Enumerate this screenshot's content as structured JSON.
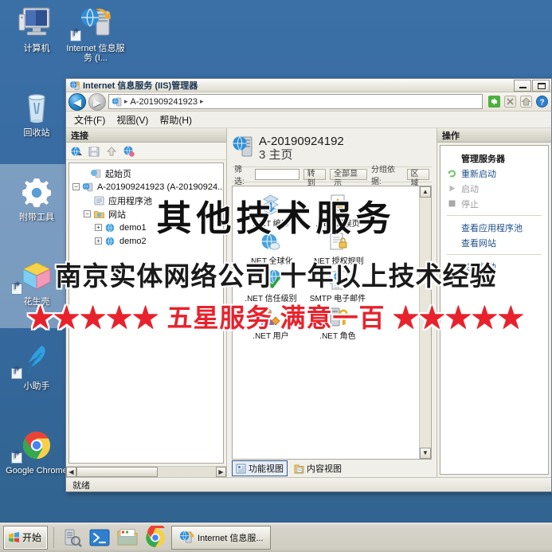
{
  "desktop": {
    "background_color": "#3a6ea5",
    "icons": [
      {
        "name": "computer",
        "label": "计算机",
        "icon": "monitor-icon",
        "shortcut": false
      },
      {
        "name": "iis-manager-shortcut",
        "label": "Internet 信息服务 (I...",
        "icon": "iis-server-icon",
        "shortcut": true
      },
      {
        "name": "recycle-bin",
        "label": "回收站",
        "icon": "recycle-bin-icon",
        "shortcut": false
      },
      {
        "name": "bundled-tools",
        "label": "附带工具",
        "icon": "gear-icon",
        "shortcut": false
      },
      {
        "name": "peanut-shell",
        "label": "花生壳",
        "icon": "cube-icon",
        "shortcut": true
      },
      {
        "name": "assistant",
        "label": "小助手",
        "icon": "feather-icon",
        "shortcut": true
      },
      {
        "name": "google-chrome",
        "label": "Google Chrome",
        "icon": "chrome-icon",
        "shortcut": true
      }
    ]
  },
  "watermarks": {
    "line1": "其他技术服务",
    "line2": "南京实体网络公司  十年以上技术经验",
    "line3": "★★★★★ 五星服务 满意一百 ★★★★★",
    "line3_color": "#e8222c"
  },
  "window": {
    "title": "Internet 信息服务 (IIS)管理器",
    "title_icon": "iis-server-icon",
    "buttons": {
      "minimize": "minimize-icon",
      "maximize": "maximize-icon"
    },
    "address": {
      "icon": "server-icon",
      "separator": "▸",
      "value": "A-201909241923",
      "trailing_separator": "▸"
    },
    "toolbar_icons": [
      "refresh-icon",
      "stop-icon",
      "home-icon",
      "help-icon"
    ],
    "menu": [
      {
        "name": "file",
        "label": "文件(F)"
      },
      {
        "name": "view",
        "label": "视图(V)"
      },
      {
        "name": "help",
        "label": "帮助(H)"
      }
    ],
    "connections": {
      "header": "连接",
      "toolbar_icons": [
        "connect-icon",
        "save-icon",
        "disconnect-icon",
        "connect-site-icon"
      ],
      "tree": [
        {
          "label": "起始页",
          "indent": 1,
          "expander": "",
          "icon": "start-page-icon"
        },
        {
          "label": "A-201909241923 (A-20190924...",
          "indent": 0,
          "expander": "−",
          "icon": "server-icon"
        },
        {
          "label": "应用程序池",
          "indent": 1,
          "expander": "",
          "icon": "app-pool-icon"
        },
        {
          "label": "网站",
          "indent": 1,
          "expander": "−",
          "icon": "sites-folder-icon"
        },
        {
          "label": "demo1",
          "indent": 2,
          "expander": "+",
          "icon": "site-icon"
        },
        {
          "label": "demo2",
          "indent": 2,
          "expander": "+",
          "icon": "site-icon"
        }
      ],
      "hscroll": "horizontal-scrollbar"
    },
    "main": {
      "page_icon": "server-icon",
      "title_line1": "A-20190924192",
      "title_line2": "3  主页",
      "filter": {
        "label": "筛选:",
        "go_label": "转到",
        "show_all_label": "全部显示",
        "group_label": "分组依据:",
        "group_value": "区域"
      },
      "features": [
        {
          "name": "net-compilation",
          "label": ".NET 编译",
          "icon": "net-compilation-icon"
        },
        {
          "name": "net-error-pages",
          "label": ".NET 错误页",
          "icon": "error-pages-icon"
        },
        {
          "name": "net-globalization",
          "label": ".NET 全球化",
          "icon": "globalization-icon"
        },
        {
          "name": "net-authorization-rules",
          "label": ".NET 授权规则",
          "icon": "authorization-icon"
        },
        {
          "name": "net-trust-levels",
          "label": ".NET 信任级别",
          "icon": "trust-levels-icon"
        },
        {
          "name": "smtp-email",
          "label": "SMTP 电子邮件",
          "icon": "smtp-email-icon"
        },
        {
          "name": "net-users",
          "label": ".NET 用户",
          "icon": "users-icon"
        },
        {
          "name": "net-roles",
          "label": ".NET 角色",
          "icon": "roles-key-icon"
        }
      ],
      "view_tabs": [
        {
          "name": "features-view",
          "label": "功能视图",
          "icon": "features-view-icon",
          "active": true
        },
        {
          "name": "content-view",
          "label": "内容视图",
          "icon": "content-view-icon",
          "active": false
        }
      ]
    },
    "actions": {
      "header": "操作",
      "items": [
        {
          "label": "管理服务器",
          "icon": "",
          "state": "bold"
        },
        {
          "label": "重新启动",
          "icon": "restart-icon",
          "state": "normal"
        },
        {
          "label": "启动",
          "icon": "play-icon",
          "state": "disabled"
        },
        {
          "label": "停止",
          "icon": "stop-square-icon",
          "state": "disabled"
        },
        {
          "label": "查看应用程序池",
          "icon": "",
          "state": "normal"
        },
        {
          "label": "查看网站",
          "icon": "",
          "state": "normal"
        },
        {
          "label": "联机帮助",
          "icon": "",
          "state": "normal"
        }
      ]
    },
    "status": "就绪"
  },
  "taskbar": {
    "start_label": "开始",
    "start_icon": "windows-flag-icon",
    "quick_launch": [
      {
        "name": "server-manager",
        "icon": "server-manager-icon"
      },
      {
        "name": "powershell",
        "icon": "powershell-icon"
      },
      {
        "name": "file-explorer",
        "icon": "folder-icon"
      },
      {
        "name": "chrome",
        "icon": "chrome-icon"
      }
    ],
    "tasks": [
      {
        "name": "iis-manager-task",
        "label": "Internet 信息服...",
        "icon": "iis-server-icon"
      }
    ]
  }
}
